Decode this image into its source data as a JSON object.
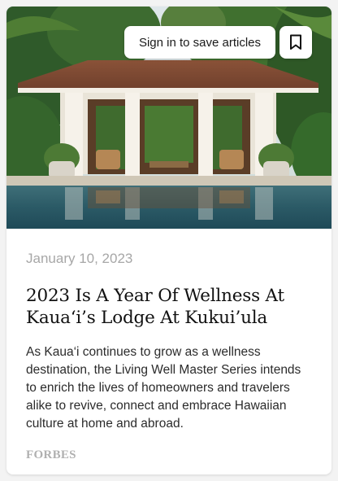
{
  "card": {
    "signin_label": "Sign in to save articles",
    "date": "January 10, 2023",
    "headline": "2023 Is A Year Of Wellness At Kaua‘i’s Lodge At Kukui’ula",
    "excerpt": "As Kaua‘i continues to grow as a wellness destination, the Living Well Master Series intends to enrich the lives of homeowners and travelers alike to revive, connect and embrace Hawaiian culture at home and abroad.",
    "source": "FORBES"
  },
  "icons": {
    "bookmark": "bookmark-icon"
  },
  "colors": {
    "date": "#a7a7a7",
    "headline": "#111111",
    "excerpt": "#2b2b2b",
    "source": "#b0b0b0"
  }
}
